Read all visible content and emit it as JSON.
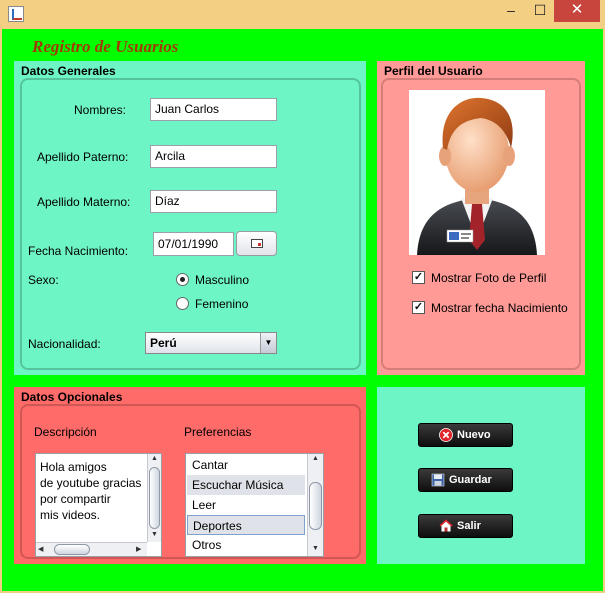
{
  "window": {
    "title": "",
    "minimize": "–",
    "maximize": "☐",
    "close": "✕"
  },
  "form_title": "Registro de Usuarios",
  "datos_generales": {
    "title": "Datos Generales",
    "nombres_label": "Nombres:",
    "nombres_value": "Juan Carlos",
    "paterno_label": "Apellido Paterno:",
    "paterno_value": "Arcila",
    "materno_label": "Apellido Materno:",
    "materno_value": "Díaz",
    "fecha_label": "Fecha Nacimiento:",
    "fecha_value": "07/01/1990",
    "sexo_label": "Sexo:",
    "sexo_options": [
      "Masculino",
      "Femenino"
    ],
    "sexo_selected": "Masculino",
    "nacionalidad_label": "Nacionalidad:",
    "nacionalidad_value": "Perú"
  },
  "perfil": {
    "title": "Perfil del Usuario",
    "mostrar_foto": "Mostrar Foto de Perfil",
    "mostrar_fecha": "Mostrar fecha Nacimiento",
    "mostrar_foto_checked": true,
    "mostrar_fecha_checked": true
  },
  "opcionales": {
    "title": "Datos Opcionales",
    "descripcion_label": "Descripción",
    "descripcion_lines": [
      "Hola amigos",
      "de youtube gracias",
      "por compartir",
      "mis videos."
    ],
    "preferencias_label": "Preferencias",
    "preferencias": [
      "Cantar",
      "Escuchar Música",
      "Leer",
      "Deportes",
      "Otros"
    ],
    "preferencias_selected": [
      "Escuchar Música",
      "Deportes"
    ]
  },
  "actions": {
    "nuevo": "Nuevo",
    "guardar": "Guardar",
    "salir": "Salir"
  },
  "colors": {
    "frame": "#00ff00",
    "general_bg": "#6ef5c5",
    "perfil_bg": "#ff9a96",
    "opcional_bg": "#ff6b68",
    "title_text": "#a33b00"
  },
  "icons": {
    "nuevo": "red-x-circle-icon",
    "guardar": "floppy-disk-icon",
    "salir": "home-icon",
    "fecha": "calendar-icon"
  }
}
